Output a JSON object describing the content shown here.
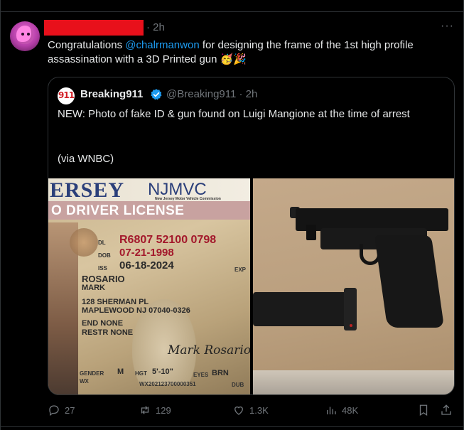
{
  "post": {
    "time": "2h",
    "more_label": "···",
    "text_before": "Congratulations ",
    "mention": "@chalrmanwon",
    "text_after": " for designing the frame of the 1st high profile assassination with a 3D Printed gun 🥳🎉"
  },
  "quote": {
    "avatar_text": "911",
    "name": "Breaking911",
    "handle_time": "@Breaking911 · 2h",
    "text": "NEW: Photo of fake ID & gun found on Luigi Mangione at the time of arrest",
    "via": "(via WNBC)"
  },
  "license": {
    "state": "ERSEY",
    "mvc": "NJMVC",
    "mvc_sub": "New Jersey Motor Vehicle Commission",
    "bar": "O DRIVER LICENSE",
    "dl_label": "DL",
    "dl": "R6807 52100 0798",
    "dob_label": "DOB",
    "dob": "07-21-1998",
    "iss_label": "ISS",
    "iss": "06-18-2024",
    "exp_label": "EXP",
    "last_name": "ROSARIO",
    "first_name": "MARK",
    "address1": "128 SHERMAN PL",
    "address2": "MAPLEWOOD NJ 07040-0326",
    "end": "END  NONE",
    "restr": "RESTR NONE",
    "signature": "Mark Rosario",
    "gender_label": "GENDER",
    "gender": "M",
    "hgt_label": "HGT",
    "hgt": "5'-10\"",
    "eyes_label": "EYES",
    "eyes": "BRN",
    "wx": "WX",
    "doc_no": "WX202123700000351",
    "dub": "DUB"
  },
  "actions": {
    "replies": "27",
    "reposts": "129",
    "likes": "1.3K",
    "views": "48K"
  },
  "colors": {
    "background": "#000000",
    "text": "#e7e9ea",
    "muted": "#71767b",
    "link": "#1d9bf0",
    "border": "#2f3336",
    "redaction": "#e8101b"
  }
}
